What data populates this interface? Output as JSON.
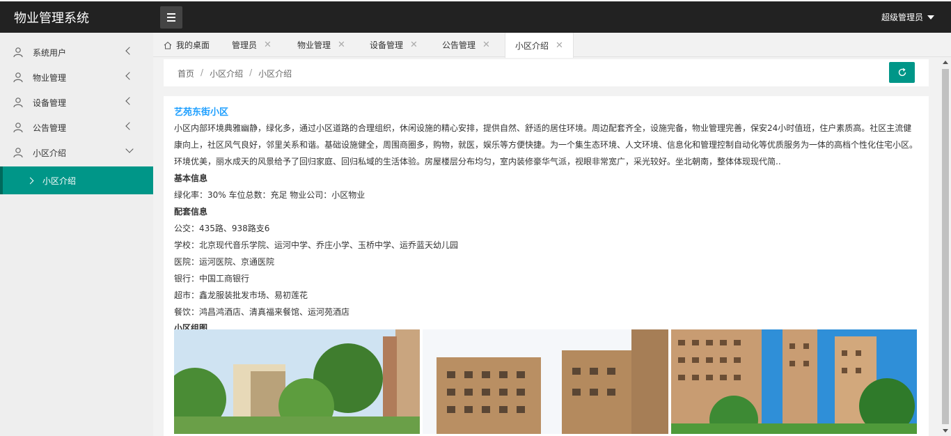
{
  "header": {
    "brand": "物业管理系统",
    "user_label": "超级管理员"
  },
  "sidebar": {
    "items": [
      {
        "label": "系统用户"
      },
      {
        "label": "物业管理"
      },
      {
        "label": "设备管理"
      },
      {
        "label": "公告管理"
      },
      {
        "label": "小区介绍"
      }
    ],
    "sub_item": {
      "label": "小区介绍"
    }
  },
  "tabs": [
    {
      "label": "我的桌面"
    },
    {
      "label": "管理员"
    },
    {
      "label": "物业管理"
    },
    {
      "label": "设备管理"
    },
    {
      "label": "公告管理"
    },
    {
      "label": "小区介绍"
    }
  ],
  "breadcrumb": {
    "items": [
      "首页",
      "小区介绍",
      "小区介绍"
    ],
    "separator": "/"
  },
  "article": {
    "title": "艺苑东街小区",
    "intro": "小区内部环境典雅幽静，绿化多，通过小区道路的合理组织，休闲设施的精心安排，提供自然、舒适的居住环境。周边配套齐全，设施完备，物业管理完善，保安24小时值班，住户素质高。社区主流健康向上，社区风气良好，邻里关系和谐。基础设施健全，周围商圈多，购物，就医，娱乐等方便快捷。为一个集生态环境、人文环境、信息化和管理控制自动化等优质服务为一体的高档个性化住宅小区。环境优美，丽水成天的风景给予了回归家庭、回归私域的生活体验。房屋楼层分布均匀，室内装修豪华气派，视眼非常宽广，采光较好。坐北朝南，整体体现现代简..",
    "basic_title": "基本信息",
    "basic_info": "绿化率：30% 车位总数：充足 物业公司：小区物业",
    "facility_title": "配套信息",
    "facilities": [
      "公交：435路、938路支6",
      "学校：北京现代音乐学院、运河中学、乔庄小学、玉桥中学、运乔蓝天幼儿园",
      "医院：运河医院、京通医院",
      "银行：中国工商银行",
      "超市：鑫龙服装批发市场、易初莲花",
      "餐饮：鸿昌鸿酒店、清真福来餐馆、运河苑酒店"
    ],
    "gallery_title": "小区组图"
  },
  "colors": {
    "accent": "#009688",
    "title_blue": "#1e9fff",
    "header_bg": "#222222"
  },
  "icons": {
    "menu": "hamburger-icon",
    "user": "user-icon",
    "home": "home-icon",
    "refresh": "refresh-icon",
    "close": "close-icon"
  }
}
